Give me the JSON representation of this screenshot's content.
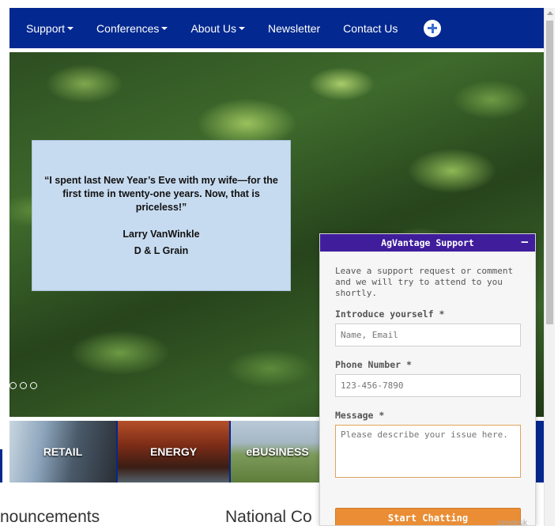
{
  "nav": {
    "items": [
      {
        "label": "Support",
        "dropdown": true
      },
      {
        "label": "Conferences",
        "dropdown": true
      },
      {
        "label": "About Us",
        "dropdown": true
      },
      {
        "label": "Newsletter",
        "dropdown": false
      },
      {
        "label": "Contact Us",
        "dropdown": false
      }
    ],
    "plus_icon": "plus-circle-icon",
    "background": "#03288f"
  },
  "hero": {
    "quote": "“I spent last New Year’s Eve with my wife—for the first time in twenty-one years.  Now, that is priceless!”",
    "author": "Larry VanWinkle",
    "company": "D & L Grain"
  },
  "tiles": [
    {
      "label": "RETAIL"
    },
    {
      "label": "ENERGY"
    },
    {
      "label": "eBUSINESS"
    }
  ],
  "headings": {
    "left": "nouncements",
    "middle": "National Co"
  },
  "widget": {
    "title": "AgVantage Support",
    "minimize": "–",
    "intro": "Leave a support request or comment and we will try to attend to you shortly.",
    "name_label": "Introduce yourself *",
    "name_placeholder": "Name, Email",
    "phone_label": "Phone Number *",
    "phone_placeholder": "123-456-7890",
    "message_label": "Message *",
    "message_placeholder": "Please describe your issue here.",
    "button": "Start Chatting",
    "brand": "zendesk",
    "header_color": "#3f1d9b",
    "button_color": "#ea8d35"
  }
}
